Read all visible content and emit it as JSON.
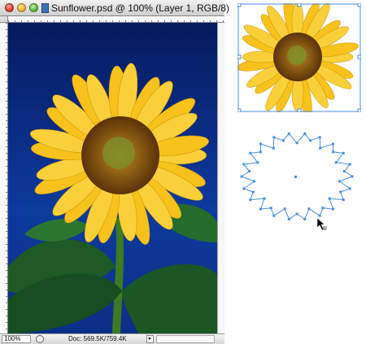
{
  "window": {
    "title": "Sunflower.psd @ 100% (Layer 1, RGB/8)"
  },
  "status_bar": {
    "zoom": "100%",
    "doc_size": "Doc: 569.5K/759.4K"
  },
  "icons": {
    "close": "close-button",
    "minimize": "minimize-button",
    "zoom": "zoom-button",
    "document": "document-icon",
    "status_menu": "triangle-right-icon",
    "cursor": "direct-selection-cursor-icon"
  },
  "colors": {
    "sky": "#0a2f8c",
    "petal": "#f7c21b",
    "center": "#7a4a12",
    "leaf": "#1f6a2e",
    "path": "#4a8fe0"
  }
}
